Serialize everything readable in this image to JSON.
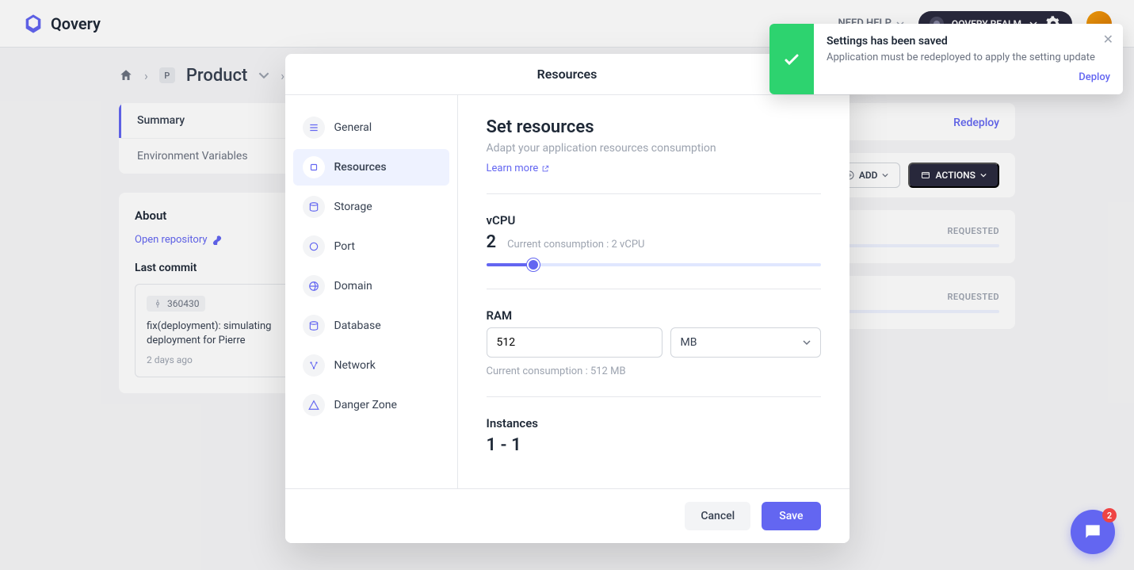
{
  "topbar": {
    "brand": "Qovery",
    "help": "NEED HELP",
    "realm": "QOVERY REALM"
  },
  "breadcrumb": {
    "badge": "P",
    "product": "Product"
  },
  "sidebar_tabs": {
    "summary": "Summary",
    "env_vars": "Environment Variables"
  },
  "about": {
    "title": "About",
    "repo_link": "Open repository",
    "last_commit_label": "Last commit",
    "commit_hash": "360430",
    "commit_msg": "fix(deployment): simulating deployment for Pierre",
    "commit_time": "2 days ago"
  },
  "right": {
    "redeploy": "Redeploy",
    "add": "ADD",
    "actions": "ACTIONS",
    "requested": "REQUESTED"
  },
  "modal": {
    "title": "Resources",
    "sidebar": {
      "general": "General",
      "resources": "Resources",
      "storage": "Storage",
      "port": "Port",
      "domain": "Domain",
      "database": "Database",
      "network": "Network",
      "danger": "Danger Zone"
    },
    "content": {
      "heading": "Set resources",
      "sub": "Adapt your application resources consumption",
      "learn_more": "Learn more",
      "vcpu_label": "vCPU",
      "vcpu_value": "2",
      "vcpu_hint": "Current consumption : 2 vCPU",
      "ram_label": "RAM",
      "ram_value": "512",
      "ram_unit": "MB",
      "ram_hint": "Current consumption : 512 MB",
      "instances_label": "Instances",
      "instances_value": "1 - 1"
    },
    "footer": {
      "cancel": "Cancel",
      "save": "Save"
    }
  },
  "toast": {
    "title": "Settings has been saved",
    "msg": "Application must be redeployed to apply the setting update",
    "action": "Deploy"
  },
  "chat": {
    "badge": "2"
  }
}
